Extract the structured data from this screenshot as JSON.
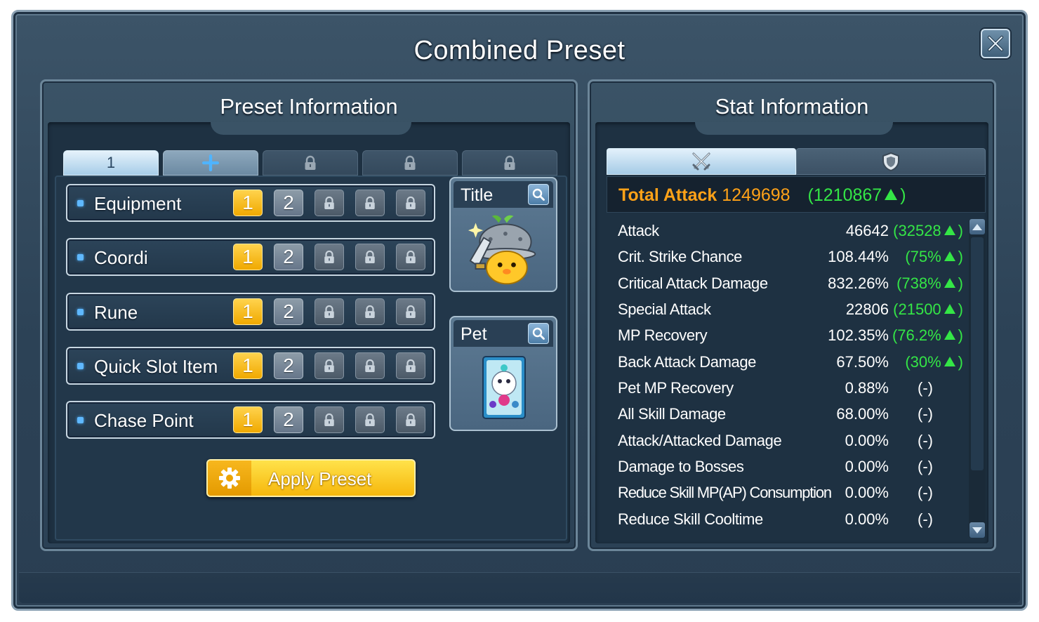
{
  "window": {
    "title": "Combined Preset"
  },
  "preset_panel": {
    "header": "Preset Information",
    "tabs": [
      {
        "label": "1",
        "state": "active"
      },
      {
        "label": "+",
        "state": "add"
      },
      {
        "label": "",
        "state": "locked"
      },
      {
        "label": "",
        "state": "locked"
      },
      {
        "label": "",
        "state": "locked"
      }
    ],
    "slots": [
      {
        "label": "Equipment",
        "btn1": "1",
        "btn2": "2"
      },
      {
        "label": "Coordi",
        "btn1": "1",
        "btn2": "2"
      },
      {
        "label": "Rune",
        "btn1": "1",
        "btn2": "2"
      },
      {
        "label": "Quick Slot Item",
        "btn1": "1",
        "btn2": "2"
      },
      {
        "label": "Chase Point",
        "btn1": "1",
        "btn2": "2"
      }
    ],
    "title_card": {
      "label": "Title"
    },
    "pet_card": {
      "label": "Pet"
    },
    "apply_button": "Apply Preset"
  },
  "stat_panel": {
    "header": "Stat Information",
    "tabs": [
      {
        "icon": "crossed-swords-icon",
        "state": "active"
      },
      {
        "icon": "shield-icon",
        "state": "inactive"
      }
    ],
    "total_attack": {
      "label": "Total Attack",
      "value": "1249698",
      "diff": "(1210867",
      "diff_close": ")"
    },
    "stats": [
      {
        "name": "Attack",
        "value": "46642",
        "diff": "(32528",
        "close": ")"
      },
      {
        "name": "Crit. Strike Chance",
        "value": "108.44%",
        "diff": "(75%",
        "close": ")"
      },
      {
        "name": "Critical Attack Damage",
        "value": "832.26%",
        "diff": "(738%",
        "close": ")"
      },
      {
        "name": "Special Attack",
        "value": "22806",
        "diff": "(21500",
        "close": ")"
      },
      {
        "name": "MP Recovery",
        "value": "102.35%",
        "diff": "(76.2%",
        "close": ")"
      },
      {
        "name": "Back Attack Damage",
        "value": "67.50%",
        "diff": "(30%",
        "close": ")"
      },
      {
        "name": "Pet MP Recovery",
        "value": "0.88%",
        "diff": "(-)"
      },
      {
        "name": "All Skill Damage",
        "value": "68.00%",
        "diff": "(-)"
      },
      {
        "name": "Attack/Attacked Damage",
        "value": "0.00%",
        "diff": "(-)"
      },
      {
        "name": "Damage to Bosses",
        "value": "0.00%",
        "diff": "(-)"
      },
      {
        "name": "Reduce Skill MP(AP) Consumption",
        "value": "0.00%",
        "diff": "(-)"
      },
      {
        "name": "Reduce Skill Cooltime",
        "value": "0.00%",
        "diff": "(-)"
      }
    ]
  },
  "colors": {
    "gold": "#ffa218",
    "green": "#34e646",
    "panel": "#2b4155"
  }
}
